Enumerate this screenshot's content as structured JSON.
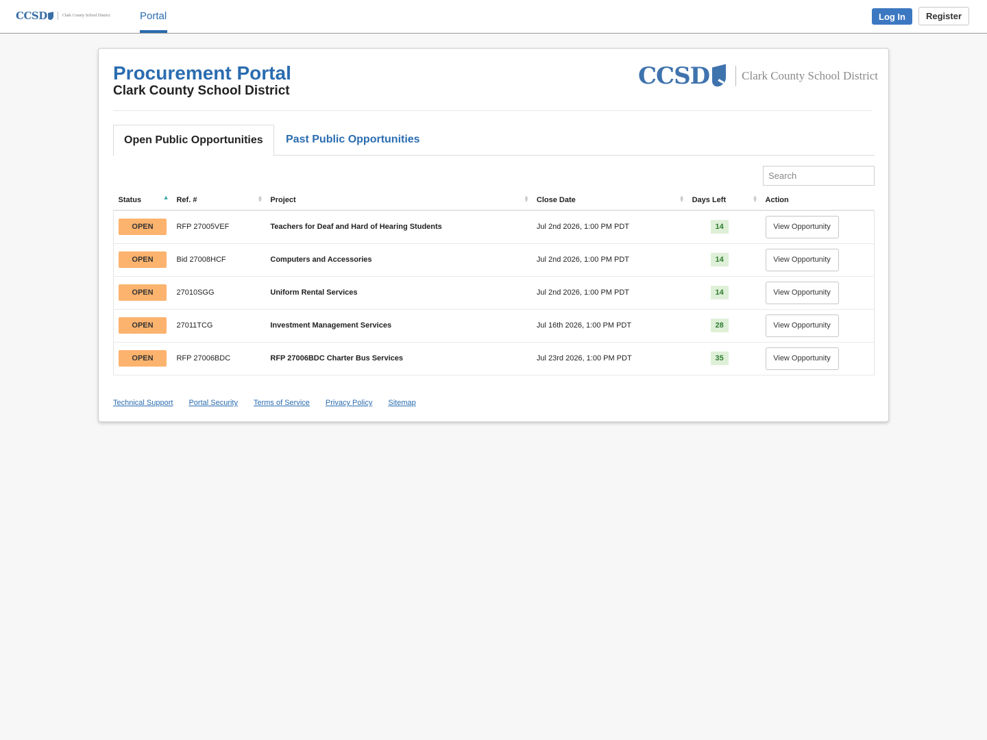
{
  "nav": {
    "logo_mark": "CCSD",
    "logo_name": "Clark County School District",
    "tab": "Portal",
    "login_label": "Log In",
    "register_label": "Register"
  },
  "header": {
    "title": "Procurement Portal",
    "subtitle": "Clark County School District",
    "logo_mark": "CCSD",
    "logo_name": "Clark County School District"
  },
  "tabs": [
    "Open Public Opportunities",
    "Past Public Opportunities"
  ],
  "search": {
    "placeholder": "Search"
  },
  "table": {
    "columns": [
      "Status",
      "Ref. #",
      "Project",
      "Close Date",
      "Days Left",
      "Action"
    ],
    "rows": [
      {
        "status": "OPEN",
        "ref": "RFP 27005VEF",
        "project": "Teachers for Deaf and Hard of Hearing Students",
        "close": "Jul 2nd 2026, 1:00 PM PDT",
        "days": "14",
        "action": "View Opportunity"
      },
      {
        "status": "OPEN",
        "ref": "Bid 27008HCF",
        "project": "Computers and Accessories",
        "close": "Jul 2nd 2026, 1:00 PM PDT",
        "days": "14",
        "action": "View Opportunity"
      },
      {
        "status": "OPEN",
        "ref": "27010SGG",
        "project": "Uniform Rental Services",
        "close": "Jul 2nd 2026, 1:00 PM PDT",
        "days": "14",
        "action": "View Opportunity"
      },
      {
        "status": "OPEN",
        "ref": "27011TCG",
        "project": "Investment Management Services",
        "close": "Jul 16th 2026, 1:00 PM PDT",
        "days": "28",
        "action": "View Opportunity"
      },
      {
        "status": "OPEN",
        "ref": "RFP 27006BDC",
        "project": "RFP 27006BDC Charter Bus Services",
        "close": "Jul 23rd 2026, 1:00 PM PDT",
        "days": "35",
        "action": "View Opportunity"
      }
    ]
  },
  "footer": [
    "Technical Support",
    "Portal Security",
    "Terms of Service",
    "Privacy Policy",
    "Sitemap"
  ],
  "colors": {
    "brand_blue": "#2a6cb0",
    "login_button": "#3c78c2",
    "open_badge": "#fbb36e",
    "days_badge_bg": "#dff0d8",
    "days_badge_text": "#2e7d32"
  }
}
